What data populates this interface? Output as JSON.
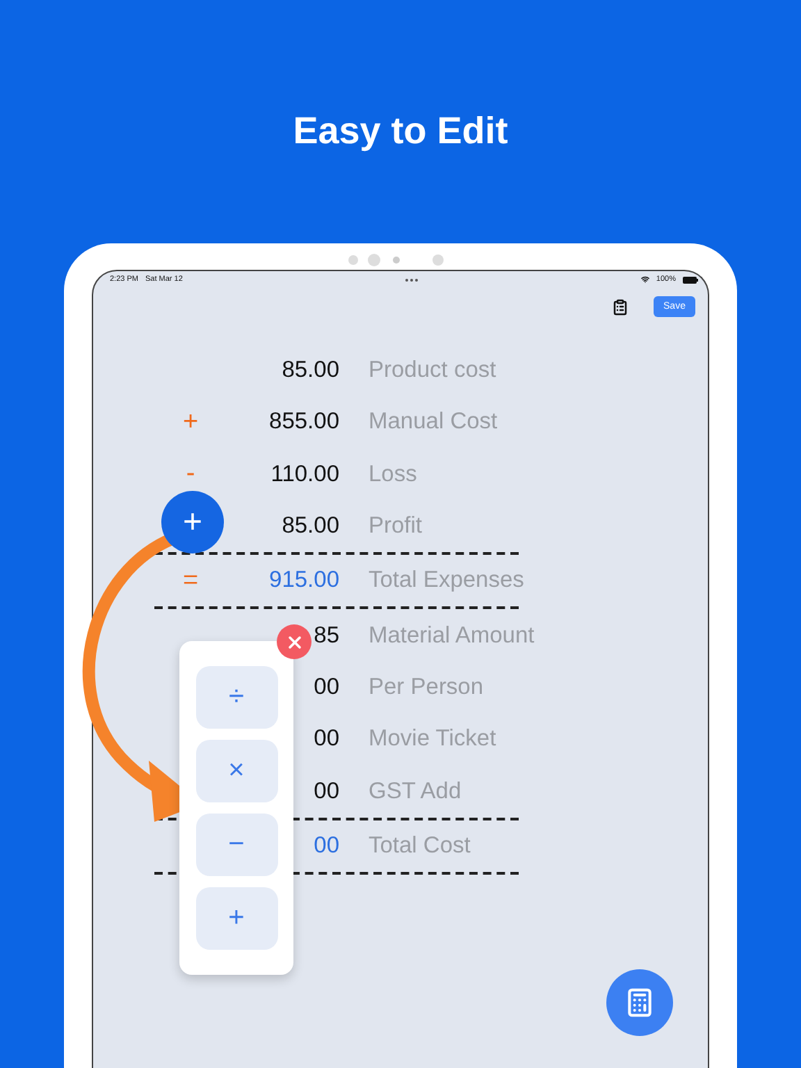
{
  "headline": "Easy to Edit",
  "status_bar": {
    "time": "2:23 PM",
    "date": "Sat Mar 12",
    "battery": "100%"
  },
  "toolbar": {
    "save": "Save"
  },
  "sections": [
    {
      "items": [
        {
          "value": "85.00",
          "label": "Product cost"
        },
        {
          "sign": "+",
          "value": "855.00",
          "label": "Manual Cost"
        },
        {
          "sign": "-",
          "value": "110.00",
          "label": "Loss"
        },
        {
          "value": "85.00",
          "label": "Profit"
        }
      ],
      "total": {
        "sign": "=",
        "value": "915.00",
        "label": "Total Expenses"
      }
    },
    {
      "items": [
        {
          "value": "85",
          "label": "Material Amount"
        },
        {
          "value": "00",
          "label": "Per Person"
        },
        {
          "value": "00",
          "label": "Movie Ticket"
        },
        {
          "value": "00",
          "label": "GST Add"
        }
      ],
      "total": {
        "value": "00",
        "label": "Total Cost"
      }
    }
  ],
  "add_button": "+",
  "operator_menu": [
    "÷",
    "×",
    "−",
    "+"
  ]
}
